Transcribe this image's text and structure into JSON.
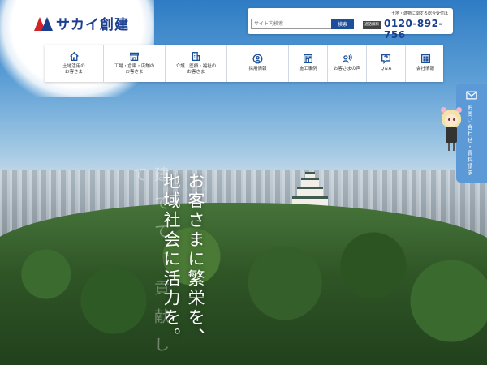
{
  "brand": {
    "name": "サカイ創建"
  },
  "search": {
    "placeholder": "サイト内検索",
    "button_label": "検索"
  },
  "contact": {
    "caption": "土地・建物に関する総合受付は",
    "free_badge": "通話無料",
    "phone": "0120-892-756"
  },
  "nav": {
    "items": [
      {
        "label": "土地活用の\nお客さま",
        "icon": "house-icon"
      },
      {
        "label": "工場・倉庫・店舗の\nお客さま",
        "icon": "shop-icon"
      },
      {
        "label": "介護・医療・福祉の\nお客さま",
        "icon": "building-icon"
      },
      {
        "label": "採用情報",
        "icon": "person-icon"
      },
      {
        "label": "施工事例",
        "icon": "case-icon"
      },
      {
        "label": "お客さまの声",
        "icon": "voice-icon"
      },
      {
        "label": "Q＆A",
        "icon": "question-icon"
      },
      {
        "label": "会社情報",
        "icon": "company-icon"
      }
    ]
  },
  "side_tab": {
    "label": "お問い合わせ・資料請求",
    "icon": "mail-icon"
  },
  "hero": {
    "line1": "お客さまに繁栄を、",
    "line2": "地域社会に活力を。",
    "ghost_text": "建てて、貢献して"
  },
  "colors": {
    "brand_blue": "#1b3f8f",
    "brand_red": "#d2252a",
    "side_tab": "#5b9ad6"
  }
}
